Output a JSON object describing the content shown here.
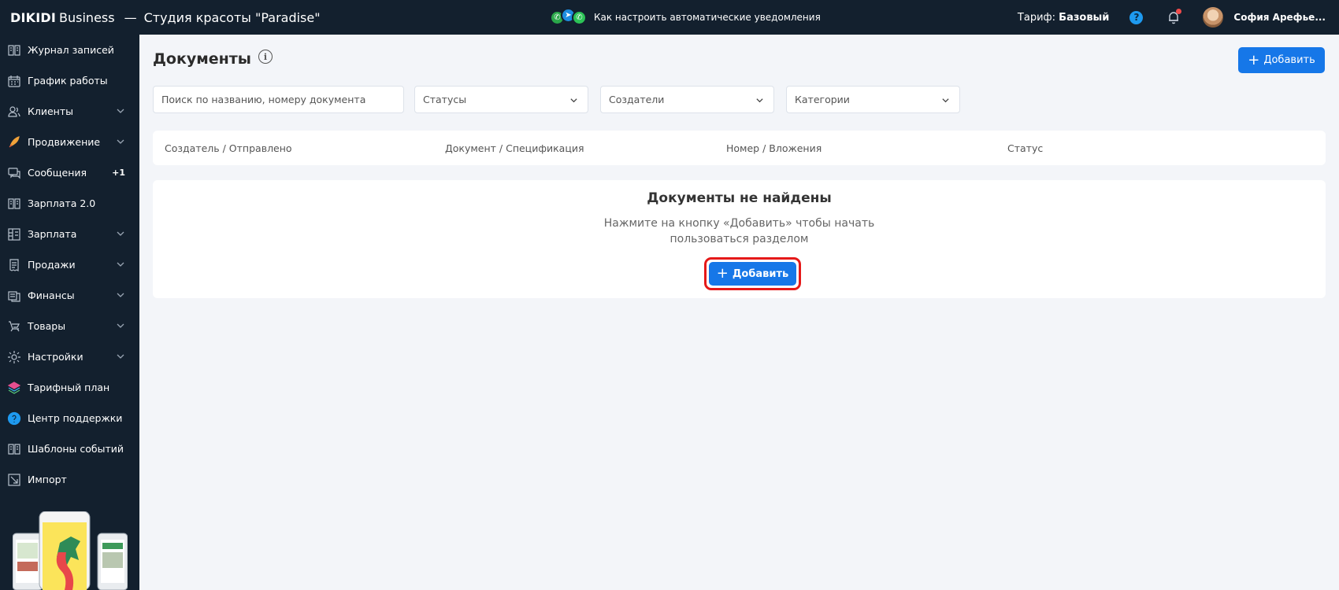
{
  "header": {
    "brand_name": "DIKIDI",
    "brand_suffix": "Business",
    "separator": "—",
    "studio_name": "Студия красоты \"Paradise\"",
    "center_link": "Как настроить автоматические уведомления",
    "tariff_label": "Тариф:",
    "tariff_value": "Базовый",
    "help_glyph": "?",
    "user_name": "София Арефье..."
  },
  "sidebar": {
    "items": [
      {
        "label": "Журнал записей",
        "icon": "journal-icon"
      },
      {
        "label": "График работы",
        "icon": "calendar-icon"
      },
      {
        "label": "Клиенты",
        "icon": "users-icon",
        "expandable": true
      },
      {
        "label": "Продвижение",
        "icon": "rocket-icon",
        "expandable": true
      },
      {
        "label": "Сообщения",
        "icon": "chat-icon",
        "badge": "+1"
      },
      {
        "label": "Зарплата 2.0",
        "icon": "book-icon"
      },
      {
        "label": "Зарплата",
        "icon": "grid-icon",
        "expandable": true
      },
      {
        "label": "Продажи",
        "icon": "receipt-icon",
        "expandable": true
      },
      {
        "label": "Финансы",
        "icon": "money-icon",
        "expandable": true
      },
      {
        "label": "Товары",
        "icon": "cart-icon",
        "expandable": true
      },
      {
        "label": "Настройки",
        "icon": "gear-icon",
        "expandable": true
      },
      {
        "label": "Тарифный план",
        "icon": "layers-icon"
      },
      {
        "label": "Центр поддержки",
        "icon": "question-icon"
      },
      {
        "label": "Шаблоны событий",
        "icon": "template-icon"
      },
      {
        "label": "Импорт",
        "icon": "import-icon"
      }
    ]
  },
  "main": {
    "title": "Документы",
    "info_glyph": "i",
    "add_label": "Добавить",
    "plus_glyph": "+",
    "search_placeholder": "Поиск по названию, номеру документа",
    "filters": [
      "Статусы",
      "Создатели",
      "Категории"
    ],
    "columns": [
      "Создатель / Отправлено",
      "Документ / Спецификация",
      "Номер / Вложения",
      "Статус"
    ],
    "empty_title": "Документы не найдены",
    "empty_text_line1": "Нажмите на кнопку «Добавить» чтобы начать",
    "empty_text_line2": "пользоваться разделом"
  },
  "colors": {
    "topbar_bg": "#13202e",
    "page_bg": "#f3f5f9",
    "primary": "#1677e8",
    "highlight": "#e51919"
  }
}
